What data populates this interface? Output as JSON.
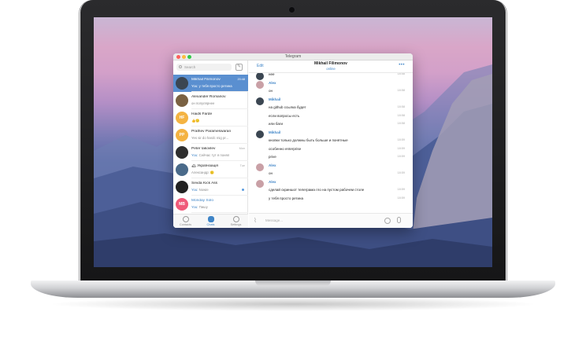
{
  "window": {
    "title": "Telegram",
    "traffic_lights": [
      "#fc605c",
      "#fdbc40",
      "#34c84a"
    ]
  },
  "sidebar": {
    "search_placeholder": "Search",
    "compose_icon": "compose-icon",
    "dialogs": [
      {
        "name": "Mikhail Filimonov",
        "preview_prefix": "You: ",
        "preview": "у тебя просто ретина",
        "time": "20:48",
        "avatar_color": "#3b4652",
        "initials": "",
        "active": true
      },
      {
        "name": "Alexander Romanov",
        "preview_prefix": "",
        "preview": "он популярнее",
        "time": "",
        "avatar_color": "#7a6142",
        "initials": "",
        "active": false
      },
      {
        "name": "Haids Farde",
        "preview_prefix": "",
        "preview": "👍🙂",
        "time": "",
        "avatar_color": "#f4b342",
        "initials": "HF",
        "active": false
      },
      {
        "name": "Prathev Parameswaran",
        "preview_prefix": "",
        "preview": "Yes sir do hardc mig pr...",
        "time": "",
        "avatar_color": "#f4b342",
        "initials": "PP",
        "active": false
      },
      {
        "name": "Peter Iakovlev",
        "preview_prefix": "You: ",
        "preview": "Сейчас тут я понял",
        "time": "Mon",
        "avatar_color": "#2f2f2f",
        "initials": "",
        "active": false
      },
      {
        "name": "🏔 Українізація",
        "preview_prefix": "",
        "preview": "Александр: 🙂",
        "time": "Tue",
        "avatar_color": "#4a6a8a",
        "initials": "",
        "active": false
      },
      {
        "name": "Sevda Kick Ass",
        "preview_prefix": "You: ",
        "preview": "Nowie",
        "time": "",
        "avatar_color": "#222222",
        "initials": "",
        "active": false
      },
      {
        "name": "Monday Solo",
        "preview_prefix": "You: ",
        "preview": "Пишу",
        "time": "",
        "avatar_color": "#f05a7a",
        "initials": "MB",
        "active": false
      }
    ],
    "tabs": [
      {
        "label": "Contacts",
        "icon": "contacts-icon"
      },
      {
        "label": "Chats",
        "icon": "chats-icon"
      },
      {
        "label": "Settings",
        "icon": "settings-icon"
      }
    ]
  },
  "chat": {
    "edit_label": "Edit",
    "peer_name": "Mikhail Filimonov",
    "peer_status": "online",
    "more_label": "•••",
    "messages": [
      {
        "author": "",
        "text": "нее",
        "time": "18:58",
        "avatar_color": "#3b4652"
      },
      {
        "author": "Alex",
        "text": "",
        "time": "",
        "avatar_color": "#c9a0a6"
      },
      {
        "author": "",
        "text": "он",
        "time": "18:58",
        "avatar_color": ""
      },
      {
        "author": "Mikhail",
        "text": "",
        "time": "",
        "avatar_color": "#3b4652"
      },
      {
        "author": "",
        "text": "на github ссылка будет",
        "time": "18:58",
        "avatar_color": ""
      },
      {
        "author": "",
        "text": "если вопросы есть",
        "time": "18:58",
        "avatar_color": ""
      },
      {
        "author": "",
        "text": "или баги",
        "time": "18:58",
        "avatar_color": ""
      },
      {
        "author": "Mikhail",
        "text": "",
        "time": "",
        "avatar_color": "#3b4652"
      },
      {
        "author": "",
        "text": "кнопки только должны быть больше и понятные",
        "time": "18:59",
        "avatar_color": ""
      },
      {
        "author": "",
        "text": "особенно enterprise",
        "time": "18:59",
        "avatar_color": ""
      },
      {
        "author": "",
        "text": "prive",
        "time": "18:59",
        "avatar_color": ""
      },
      {
        "author": "Alex",
        "text": "",
        "time": "",
        "avatar_color": "#c9a0a6"
      },
      {
        "author": "",
        "text": "он",
        "time": "18:59",
        "avatar_color": ""
      },
      {
        "author": "Alex",
        "text": "",
        "time": "",
        "avatar_color": "#c9a0a6"
      },
      {
        "author": "",
        "text": "сделай скриншот телеграма гло на пустом рабочем столе",
        "time": "18:59",
        "avatar_color": ""
      },
      {
        "author": "",
        "text": "у тебя просто ретина",
        "time": "18:59",
        "avatar_color": ""
      }
    ],
    "composer_placeholder": "Message...",
    "attach_icon": "paperclip-icon",
    "emoji_icon": "emoji-icon",
    "mic_icon": "microphone-icon"
  }
}
